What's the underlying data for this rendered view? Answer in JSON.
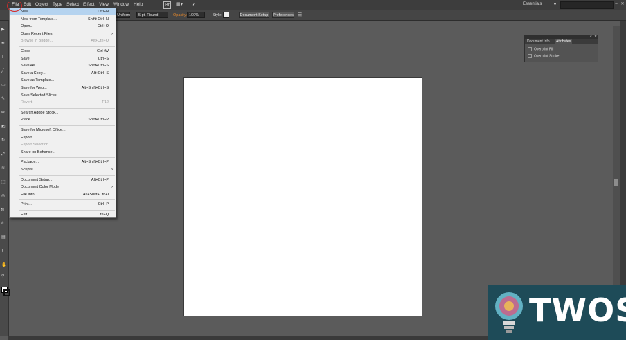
{
  "menubar": {
    "items": [
      "File",
      "Edit",
      "Object",
      "Type",
      "Select",
      "Effect",
      "View",
      "Window",
      "Help"
    ],
    "br_label": "Br",
    "workspace": "Essentials"
  },
  "controlbar": {
    "stroke_profile": "Uniform",
    "brush": "5 pt. Round",
    "opacity_label": "Opacity:",
    "opacity_value": "100%",
    "style_label": "Style:",
    "document_setup": "Document Setup",
    "preferences": "Preferences"
  },
  "panel": {
    "tabs": [
      "Document Info",
      "Attributes"
    ],
    "rows": [
      "Overprint Fill",
      "Overprint Stroke"
    ]
  },
  "file_menu": {
    "items": [
      {
        "label": "New...",
        "shortcut": "Ctrl+N",
        "highlight": true
      },
      {
        "label": "New from Template...",
        "shortcut": "Shift+Ctrl+N"
      },
      {
        "label": "Open...",
        "shortcut": "Ctrl+O"
      },
      {
        "label": "Open Recent Files",
        "submenu": true
      },
      {
        "label": "Browse in Bridge...",
        "shortcut": "Alt+Ctrl+O",
        "disabled": true
      },
      {
        "sep": true
      },
      {
        "label": "Close",
        "shortcut": "Ctrl+W"
      },
      {
        "label": "Save",
        "shortcut": "Ctrl+S"
      },
      {
        "label": "Save As...",
        "shortcut": "Shift+Ctrl+S"
      },
      {
        "label": "Save a Copy...",
        "shortcut": "Alt+Ctrl+S"
      },
      {
        "label": "Save as Template..."
      },
      {
        "label": "Save for Web...",
        "shortcut": "Alt+Shift+Ctrl+S"
      },
      {
        "label": "Save Selected Slices..."
      },
      {
        "label": "Revert",
        "shortcut": "F12",
        "disabled": true
      },
      {
        "sep": true
      },
      {
        "label": "Search Adobe Stock..."
      },
      {
        "label": "Place...",
        "shortcut": "Shift+Ctrl+P"
      },
      {
        "sep": true
      },
      {
        "label": "Save for Microsoft Office..."
      },
      {
        "label": "Export..."
      },
      {
        "label": "Export Selection...",
        "disabled": true
      },
      {
        "label": "Share on Behance..."
      },
      {
        "sep": true
      },
      {
        "label": "Package...",
        "shortcut": "Alt+Shift+Ctrl+P"
      },
      {
        "label": "Scripts",
        "submenu": true
      },
      {
        "sep": true
      },
      {
        "label": "Document Setup...",
        "shortcut": "Alt+Ctrl+P"
      },
      {
        "label": "Document Color Mode",
        "submenu": true
      },
      {
        "label": "File Info...",
        "shortcut": "Alt+Shift+Ctrl+I"
      },
      {
        "sep": true
      },
      {
        "label": "Print...",
        "shortcut": "Ctrl+P"
      },
      {
        "sep": true
      },
      {
        "label": "Exit",
        "shortcut": "Ctrl+Q"
      }
    ]
  },
  "watermark": {
    "text": "TWOS"
  },
  "colors": {
    "highlight": "#b5d3ef",
    "annotation": "#d52a2a",
    "logo_bg": "#1e4b58"
  }
}
